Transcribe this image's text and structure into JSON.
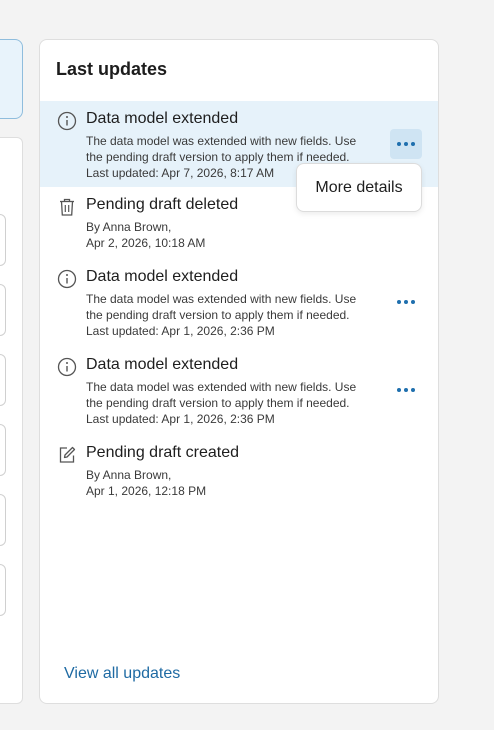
{
  "panel": {
    "title": "Last updates",
    "view_all_label": "View all updates"
  },
  "popup": {
    "more_details_label": "More details"
  },
  "updates": [
    {
      "icon": "info-icon",
      "title": "Data model extended",
      "line1": "The data model was extended with new fields. Use",
      "line2": "the pending draft version to apply them if needed.",
      "line3": "Last updated: Apr 7, 2026, 8:17 AM"
    },
    {
      "icon": "trash-icon",
      "title": "Pending draft deleted",
      "line1": "By Anna Brown,",
      "line2": "Apr 2, 2026, 10:18 AM"
    },
    {
      "icon": "info-icon",
      "title": "Data model extended",
      "line1": "The data model was extended with new fields. Use",
      "line2": "the pending draft version to apply them if needed.",
      "line3": "Last updated: Apr 1, 2026, 2:36 PM"
    },
    {
      "icon": "info-icon",
      "title": "Data model extended",
      "line1": "The data model was extended with new fields. Use",
      "line2": "the pending draft version to apply them if needed.",
      "line3": "Last updated: Apr 1, 2026, 2:36 PM"
    },
    {
      "icon": "edit-icon",
      "title": "Pending draft created",
      "line1": "By Anna Brown,",
      "line2": "Apr 1, 2026, 12:18 PM"
    }
  ],
  "colors": {
    "accent": "#1e6aa3",
    "highlight": "#e6f2fa"
  }
}
